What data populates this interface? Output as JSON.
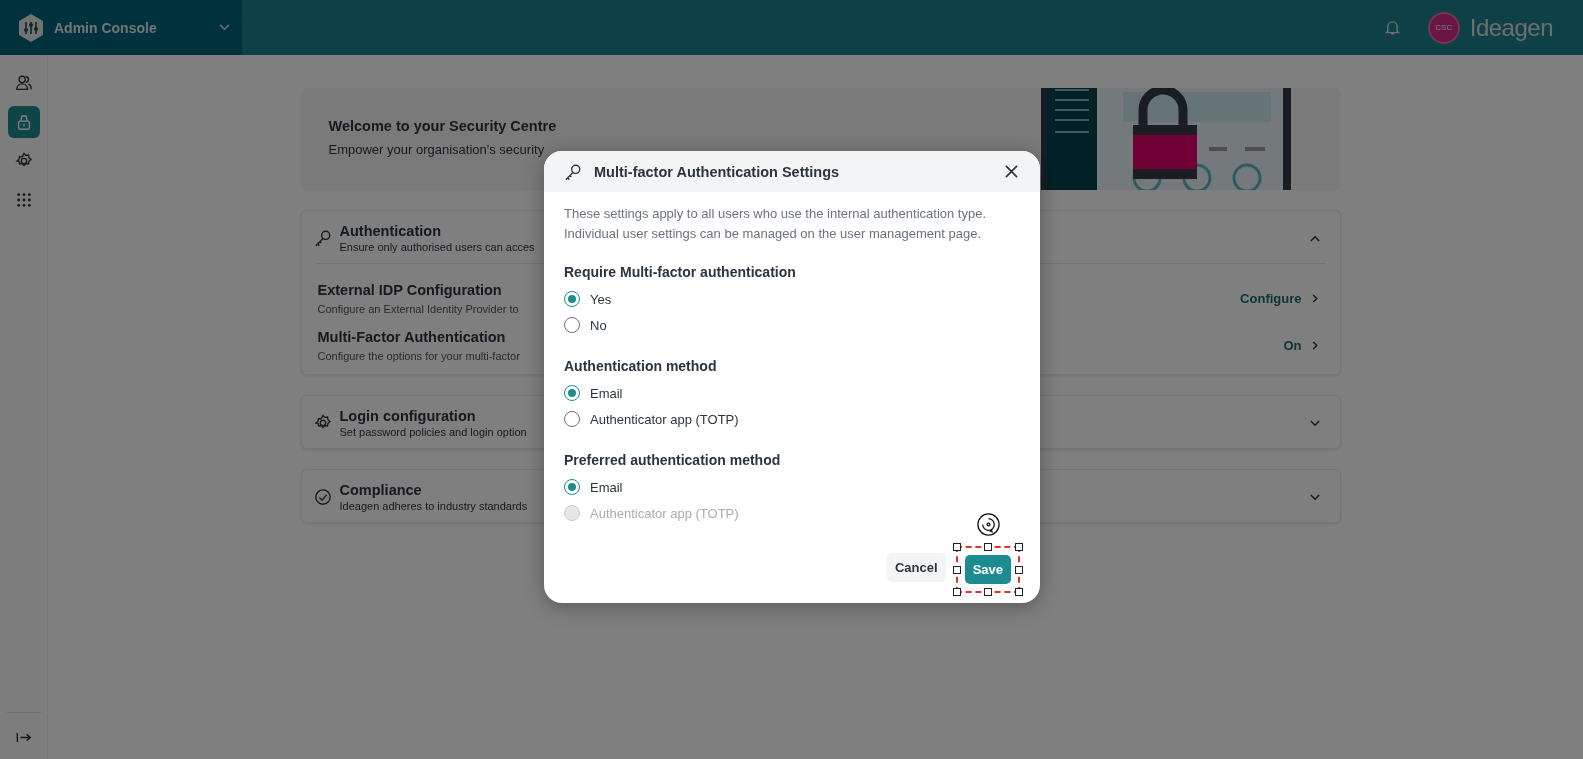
{
  "header": {
    "app_title": "Admin Console",
    "avatar": "CSC",
    "brand": "Ideagen"
  },
  "sidebar": {
    "items": [
      {
        "selected": false
      },
      {
        "selected": true
      },
      {
        "selected": false
      },
      {
        "selected": false
      }
    ]
  },
  "banner": {
    "title": "Welcome to your Security Centre",
    "text": "Empower your organisation's security"
  },
  "sections": [
    {
      "title": "Authentication",
      "subtitle": "Ensure only authorised users can acces",
      "expanded": true,
      "rows": [
        {
          "title": "External IDP Configuration",
          "text": "Configure an External Identity Provider to",
          "action": "Configure"
        },
        {
          "title": "Multi-Factor Authentication",
          "text": "Configure the options for your multi-factor",
          "action": "On"
        }
      ]
    },
    {
      "title": "Login configuration",
      "subtitle": "Set password policies and login option",
      "expanded": false
    },
    {
      "title": "Compliance",
      "subtitle": "Ideagen adheres to industry standards",
      "expanded": false
    }
  ],
  "dialog": {
    "title": "Multi-factor Authentication Settings",
    "intro": "These settings apply to all users who use the internal authentication type. Individual user settings can be managed on the user management page.",
    "groups": [
      {
        "label": "Require Multi-factor authentication",
        "options": [
          {
            "label": "Yes",
            "selected": true,
            "disabled": false
          },
          {
            "label": "No",
            "selected": false,
            "disabled": false
          }
        ]
      },
      {
        "label": "Authentication method",
        "options": [
          {
            "label": "Email",
            "selected": true,
            "disabled": false
          },
          {
            "label": "Authenticator app (TOTP)",
            "selected": false,
            "disabled": false
          }
        ]
      },
      {
        "label": "Preferred authentication method",
        "options": [
          {
            "label": "Email",
            "selected": true,
            "disabled": false
          },
          {
            "label": "Authenticator app (TOTP)",
            "selected": false,
            "disabled": true
          }
        ]
      }
    ],
    "buttons": [
      {
        "label": "Cancel",
        "kind": "secondary"
      },
      {
        "label": "Save",
        "kind": "primary"
      }
    ]
  }
}
